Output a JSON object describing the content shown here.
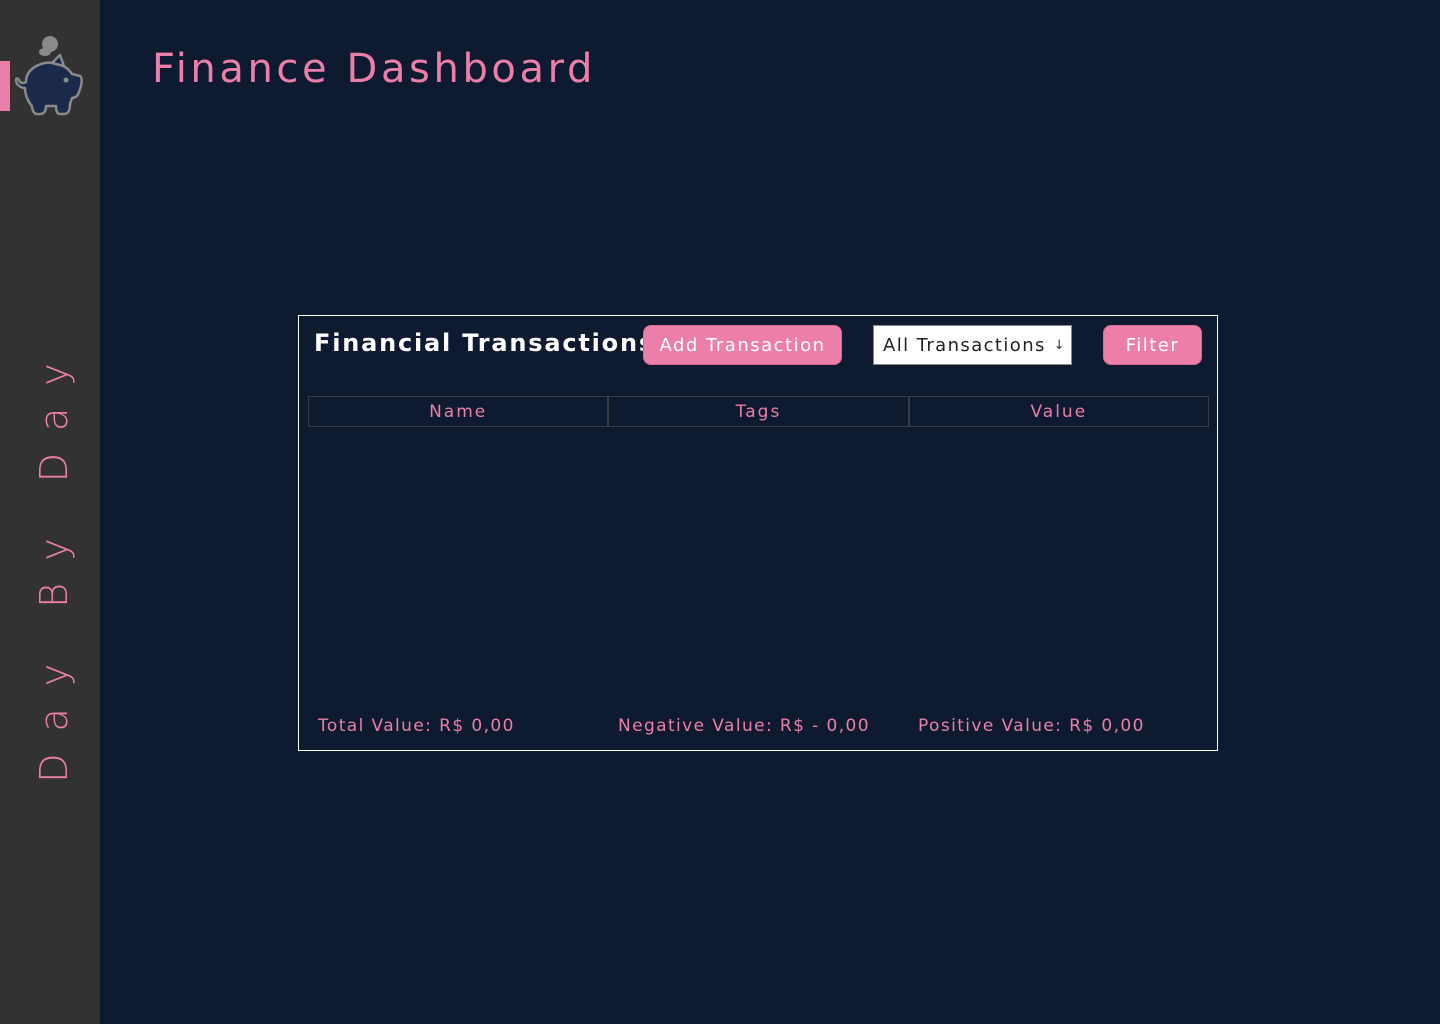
{
  "sidebar": {
    "logo_icon": "piggy-bank-icon",
    "brand_text": "Day By Day",
    "accent_color": "#ec7fa9",
    "background_color": "#333232"
  },
  "header": {
    "title": "Finance Dashboard"
  },
  "transactions": {
    "title": "Financial Transactions",
    "add_button_label": "Add Transaction",
    "select_value": "All Transactions",
    "select_icon": "arrow-down-icon",
    "filter_button_label": "Filter",
    "columns": [
      "Name",
      "Tags",
      "Value"
    ],
    "rows": [],
    "totals": {
      "total": "Total Value: R$ 0,00",
      "negative": "Negative Value: R$ - 0,00",
      "positive": "Positive Value: R$ 0,00"
    }
  },
  "colors": {
    "page_background": "#0e1a30",
    "accent": "#ec7fa9",
    "panel_border": "#ffffff"
  }
}
